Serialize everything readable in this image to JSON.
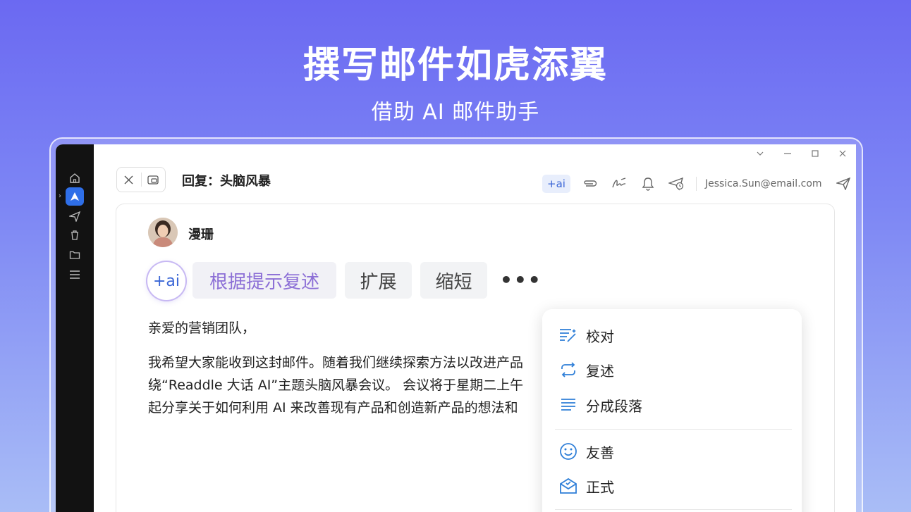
{
  "hero": {
    "title": "撰写邮件如虎添翼",
    "subtitle": "借助 AI 邮件助手"
  },
  "window": {
    "subject": "回复：头脑风暴",
    "toolbar": {
      "ai_label": "+ai",
      "account_email": "Jessica.Sun@email.com"
    }
  },
  "sidebar": {
    "items": [
      "home-icon",
      "compose-icon",
      "sent-icon",
      "trash-icon",
      "folder-icon",
      "menu-icon"
    ]
  },
  "compose": {
    "sender_name": "漫珊",
    "ai_badge": "+ai",
    "chips": {
      "rephrase": "根据提示复述",
      "expand": "扩展",
      "shorten": "缩短"
    },
    "more": "•••",
    "body_lines": [
      "亲爱的营销团队，",
      "我希望大家能收到这封邮件。随着我们继续探索方法以改进产品",
      "绕“Readdle 大话 AI”主题头脑风暴会议。 会议将于星期二上午",
      "起分享关于如何利用 AI 来改善现有产品和创造新产品的想法和"
    ]
  },
  "menu": {
    "items": [
      {
        "label": "校对",
        "icon": "proofread-icon"
      },
      {
        "label": "复述",
        "icon": "rephrase-icon"
      },
      {
        "label": "分成段落",
        "icon": "paragraphs-icon"
      },
      {
        "label": "友善",
        "icon": "smile-icon"
      },
      {
        "label": "正式",
        "icon": "formal-icon"
      }
    ]
  },
  "colors": {
    "accent": "#2f6fe8",
    "menu_icon": "#2f7fd8",
    "bg_top": "#6b69f2",
    "bg_bottom": "#a9bdf6"
  }
}
